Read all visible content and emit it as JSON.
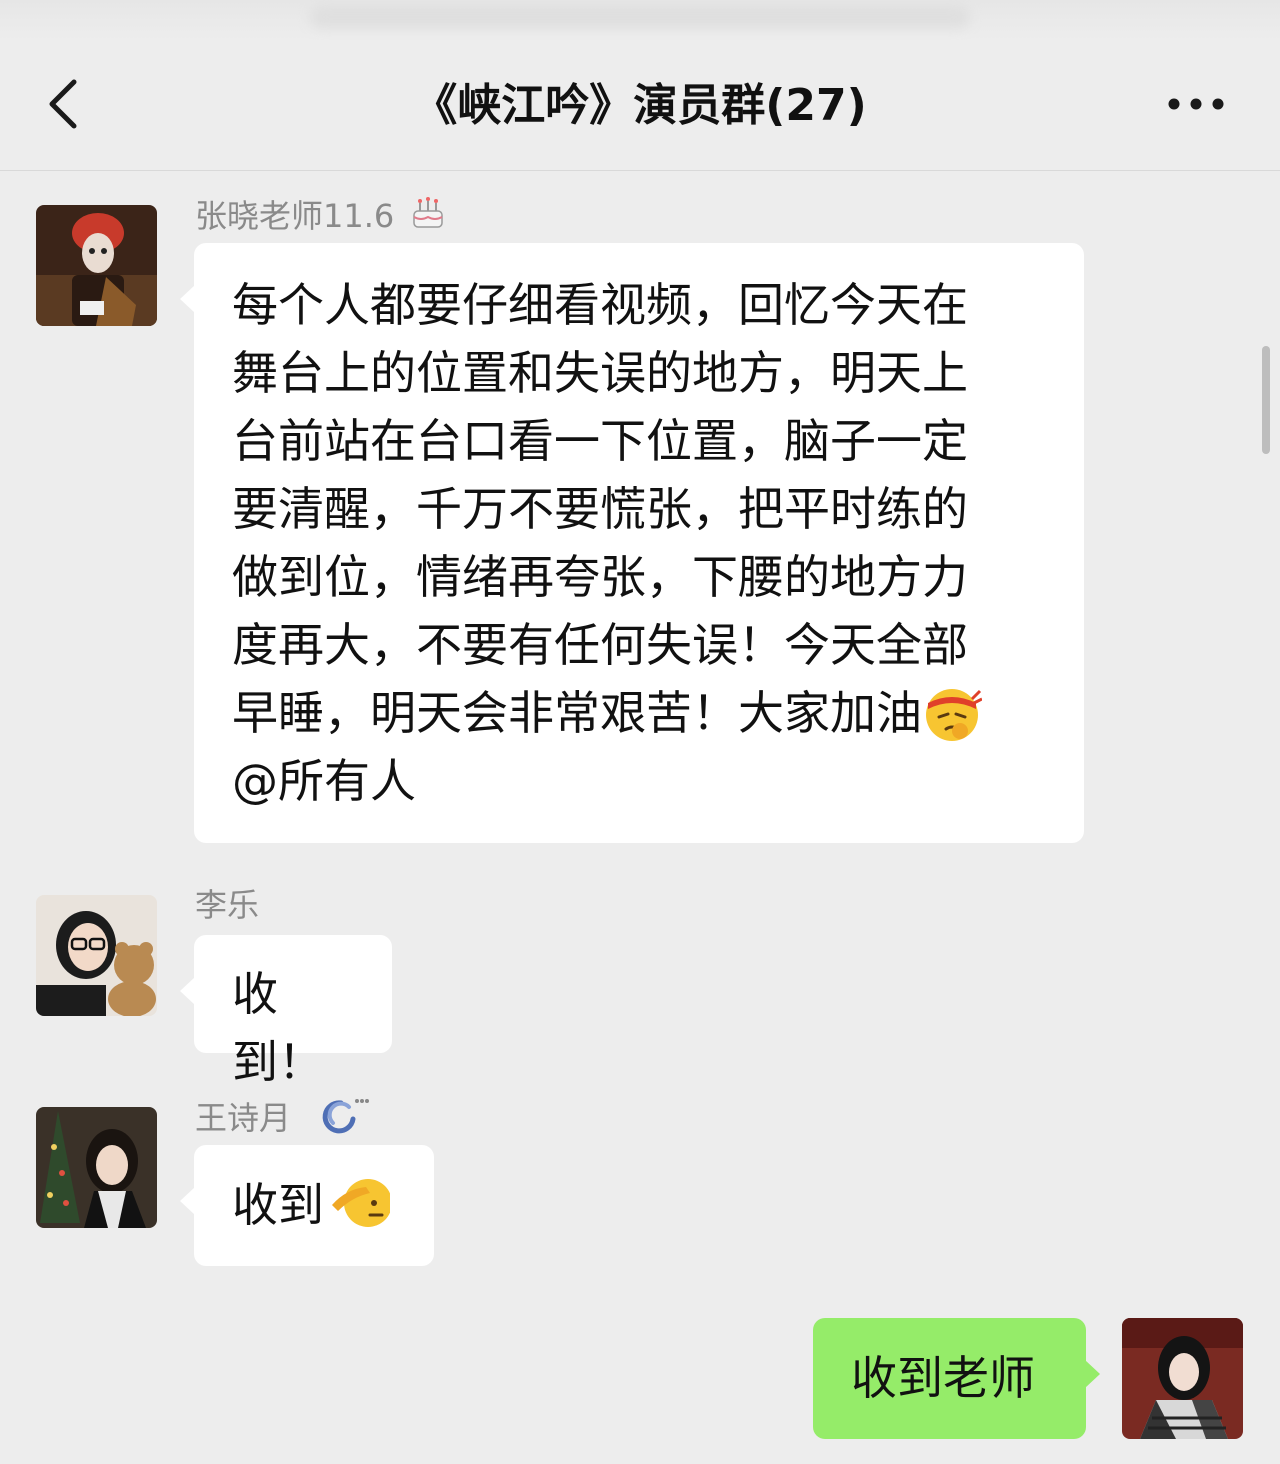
{
  "header": {
    "title": "《峡江吟》演员群(27)",
    "back_icon": "chevron-left-icon",
    "more_icon": "more-dots-icon"
  },
  "messages": [
    {
      "sender": "张晓老师11.6",
      "sender_badge": "birthday-cake-icon",
      "lines": [
        "每个人都要仔细看视频，回忆今天在",
        "舞台上的位置和失误的地方，明天上",
        "台前站在台口看一下位置，脑子一定",
        "要清醒，千万不要慌张，把平时练的",
        "做到位，情绪再夸张，下腰的地方力",
        "度再大，不要有任何失误！今天全部",
        "早睡，明天会非常艰苦！大家加油",
        "@所有人"
      ],
      "emoji": "determined-face-headband-icon"
    },
    {
      "sender": "李乐",
      "text": "收到！"
    },
    {
      "sender": "王诗月",
      "sender_badge": "status-swirl-icon",
      "text": "收到",
      "emoji": "saluting-face-icon"
    },
    {
      "sender": "",
      "text": "收到老师",
      "mine": true
    }
  ],
  "colors": {
    "background": "#ededed",
    "bubble_incoming": "#ffffff",
    "bubble_outgoing": "#95ec69",
    "sender_name": "#8a8a8a"
  }
}
